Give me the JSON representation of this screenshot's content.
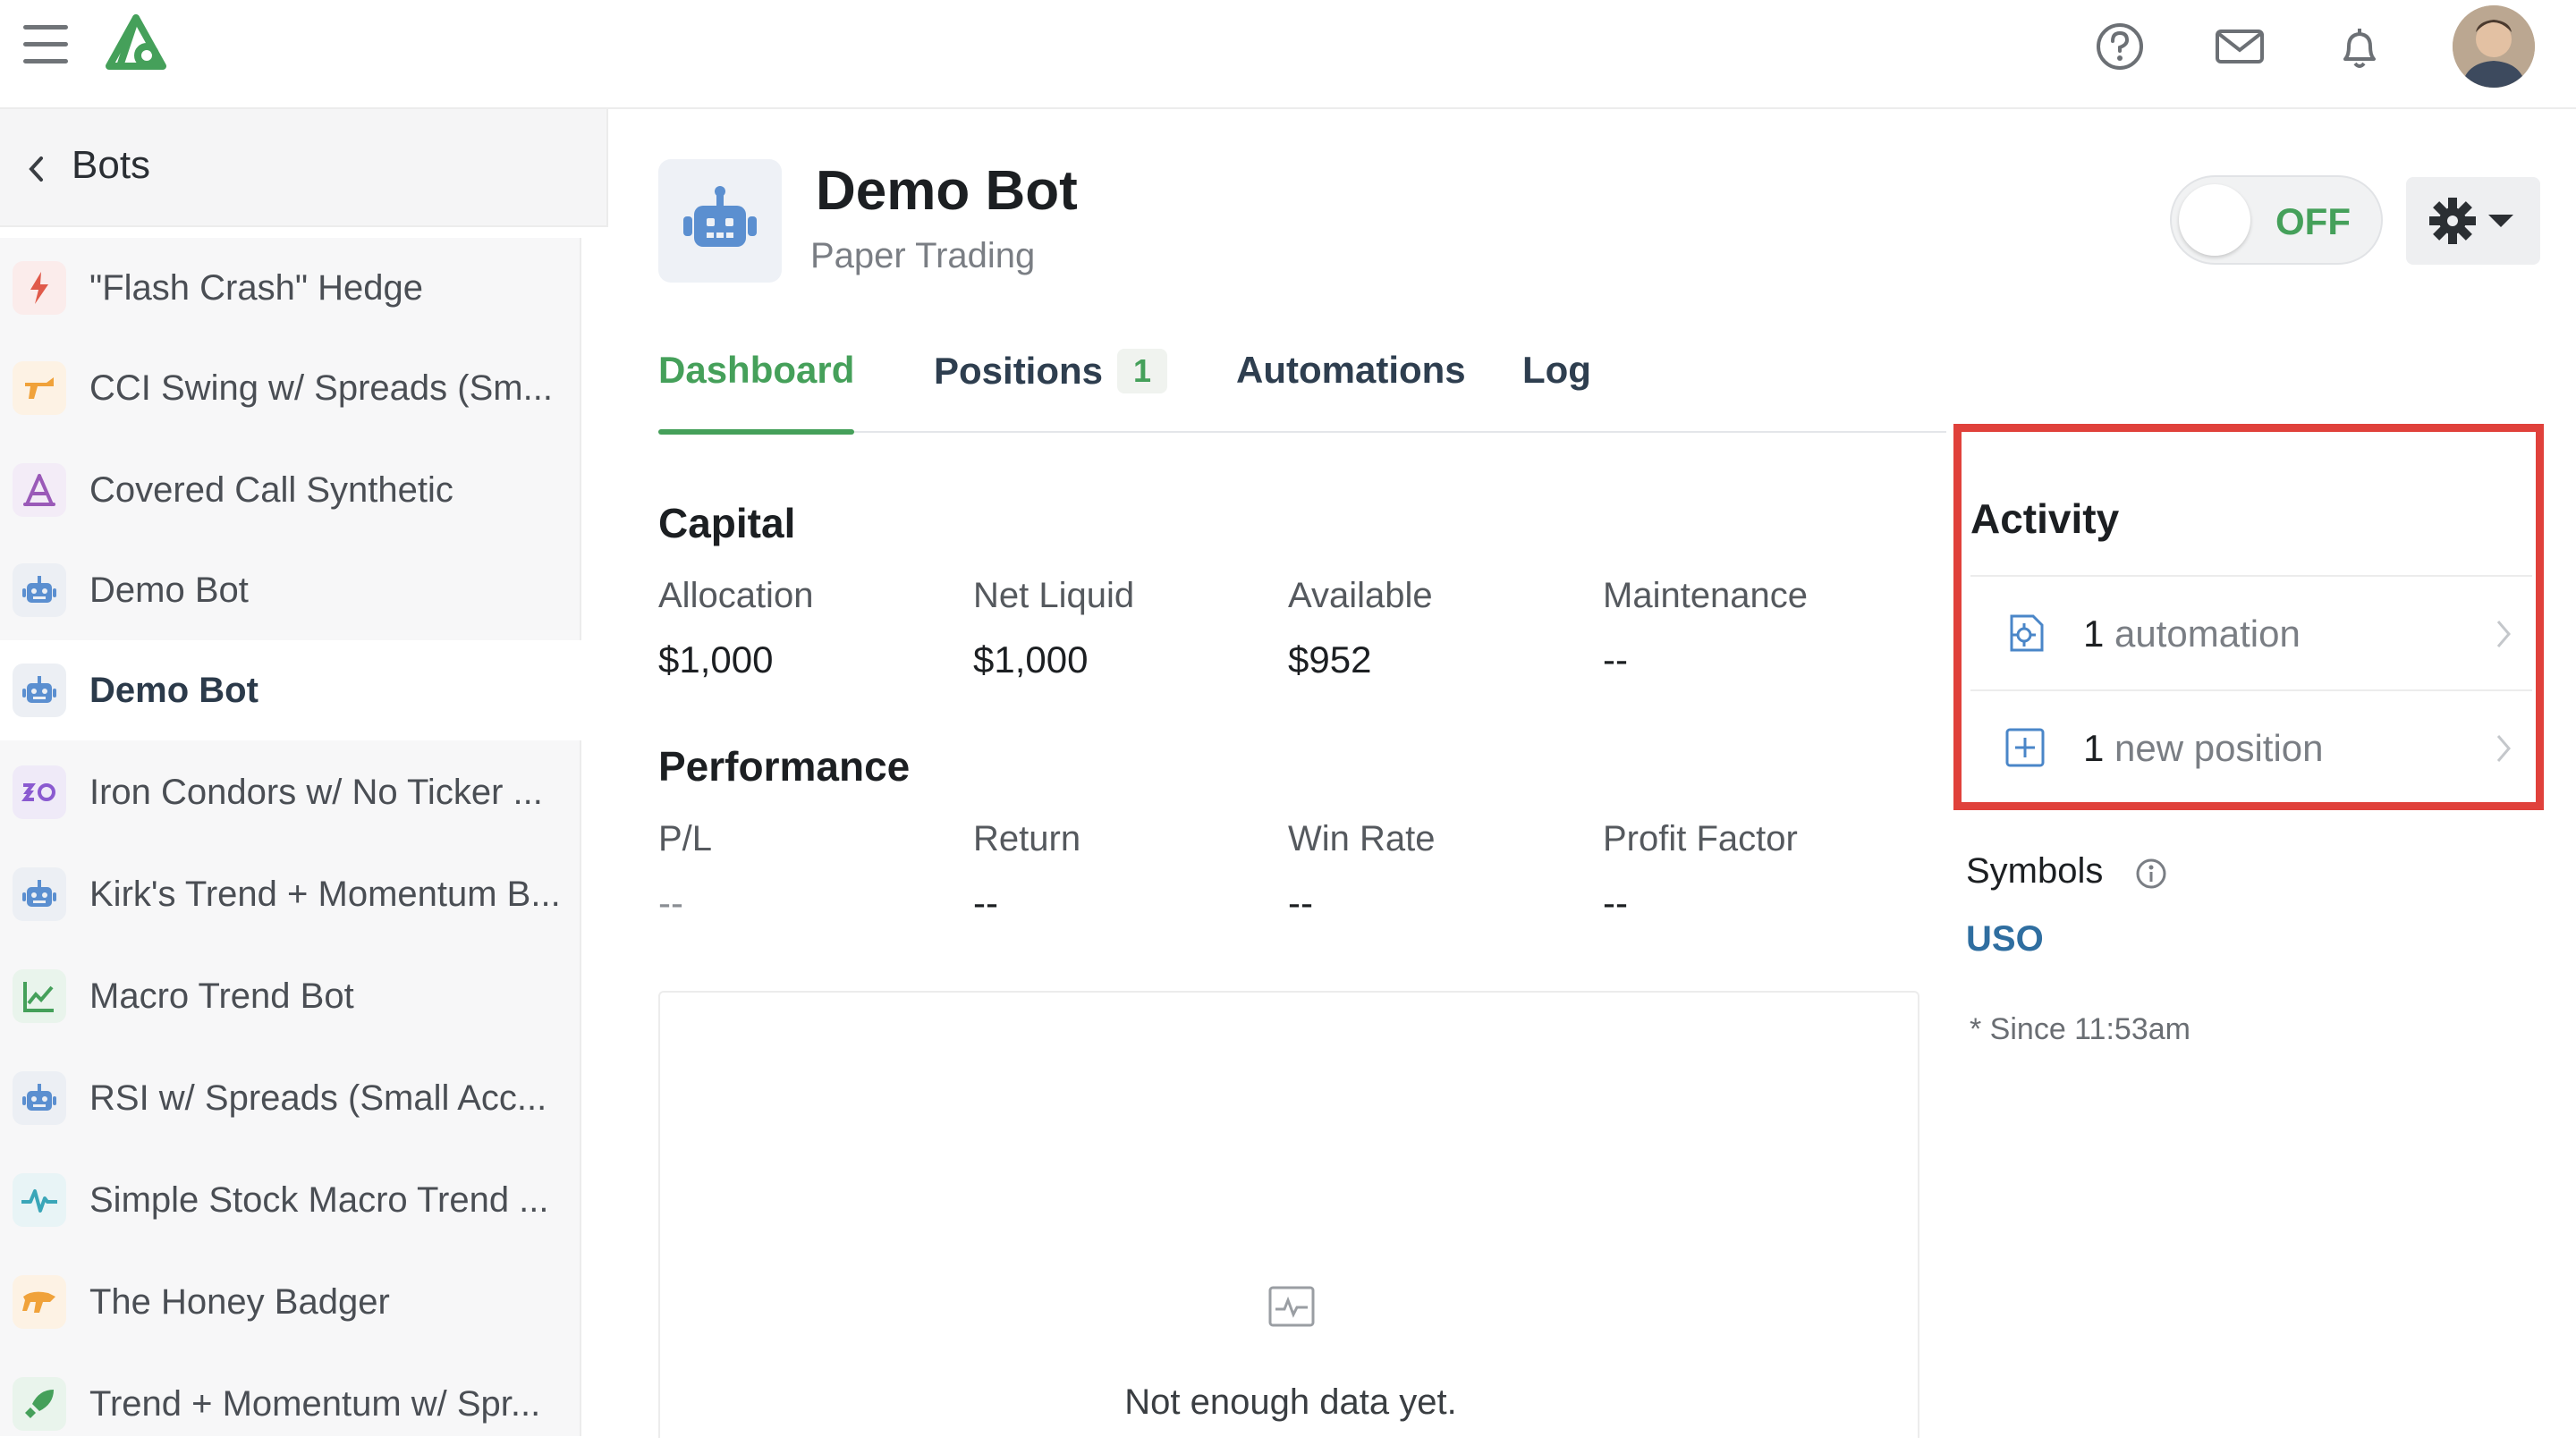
{
  "header": {
    "icons": [
      "menu-icon",
      "app-logo",
      "help-icon",
      "mail-icon",
      "bell-icon",
      "user-avatar"
    ],
    "brand_color": "#45a05a"
  },
  "sidebar": {
    "back_label": "Bots",
    "items": [
      {
        "label": "\"Flash Crash\" Hedge",
        "icon": "lightning-icon",
        "color": "#e05a4a"
      },
      {
        "label": "CCI Swing w/ Spreads (Sm...",
        "icon": "rocket-gun-icon",
        "color": "#f0a23a"
      },
      {
        "label": "Covered Call Synthetic",
        "icon": "triangle-a-icon",
        "color": "#9a5ab8"
      },
      {
        "label": "Demo Bot",
        "icon": "robot-icon",
        "color": "#5b8fd0"
      },
      {
        "label": "Demo Bot",
        "icon": "robot-icon",
        "color": "#5b8fd0",
        "active": true
      },
      {
        "label": "Iron Condors w/ No Ticker ...",
        "icon": "condor-icon",
        "color": "#8a5ad0"
      },
      {
        "label": "Kirk's Trend + Momentum B...",
        "icon": "robot-icon",
        "color": "#5b8fd0"
      },
      {
        "label": "Macro Trend Bot",
        "icon": "trend-chart-icon",
        "color": "#45a05a"
      },
      {
        "label": "RSI w/ Spreads (Small Acc...",
        "icon": "robot-icon",
        "color": "#5b8fd0"
      },
      {
        "label": "Simple Stock Macro Trend ...",
        "icon": "pulse-icon",
        "color": "#3aa6b8"
      },
      {
        "label": "The Honey Badger",
        "icon": "badger-icon",
        "color": "#f0a23a"
      },
      {
        "label": "Trend + Momentum w/ Spr...",
        "icon": "rocket-icon",
        "color": "#45a05a"
      }
    ]
  },
  "bot": {
    "name": "Demo Bot",
    "subtitle": "Paper Trading",
    "toggle_label": "OFF"
  },
  "tabs": [
    {
      "label": "Dashboard",
      "active": true
    },
    {
      "label": "Positions",
      "badge": "1"
    },
    {
      "label": "Automations"
    },
    {
      "label": "Log"
    }
  ],
  "capital": {
    "title": "Capital",
    "stats": [
      {
        "label": "Allocation",
        "value": "$1,000"
      },
      {
        "label": "Net Liquid",
        "value": "$1,000"
      },
      {
        "label": "Available",
        "value": "$952"
      },
      {
        "label": "Maintenance",
        "value": "--"
      }
    ]
  },
  "performance": {
    "title": "Performance",
    "stats": [
      {
        "label": "P/L",
        "value": "--"
      },
      {
        "label": "Return",
        "value": "--"
      },
      {
        "label": "Win Rate",
        "value": "--"
      },
      {
        "label": "Profit Factor",
        "value": "--"
      }
    ],
    "empty_text": "Not enough data yet."
  },
  "activity": {
    "title": "Activity",
    "rows": [
      {
        "count": "1",
        "label": "automation",
        "icon": "automation-gear-icon"
      },
      {
        "count": "1",
        "label": "new position",
        "icon": "plus-square-icon"
      }
    ],
    "highlight_color": "#e0413b"
  },
  "symbols": {
    "label": "Symbols",
    "items": [
      "USO"
    ],
    "since": "* Since 11:53am"
  }
}
